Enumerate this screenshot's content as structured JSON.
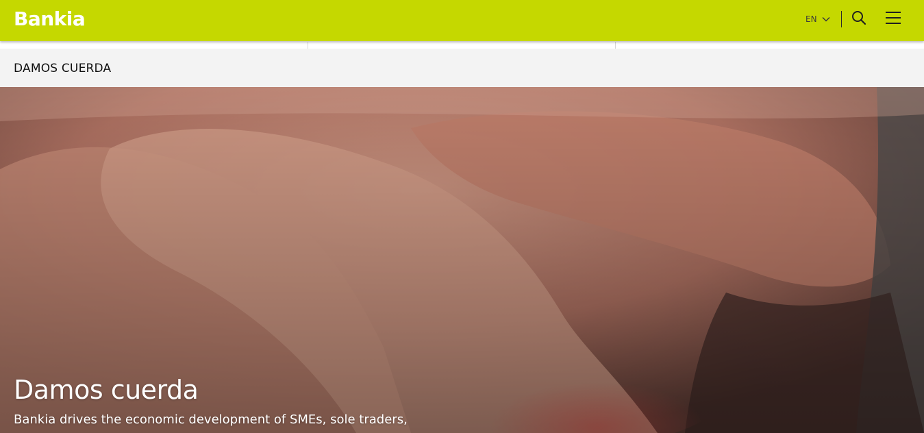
{
  "header": {
    "logo_text": "Bankia",
    "language": "EN",
    "accent_color": "#c5d800",
    "icons": [
      "chevron-down-icon",
      "search-icon",
      "menu-icon"
    ]
  },
  "section": {
    "title": "DAMOS CUERDA"
  },
  "hero": {
    "title": "Damos cuerda",
    "text": "Bankia drives the economic development of SMEs, sole traders,",
    "image": "stacked-hands-photo"
  }
}
